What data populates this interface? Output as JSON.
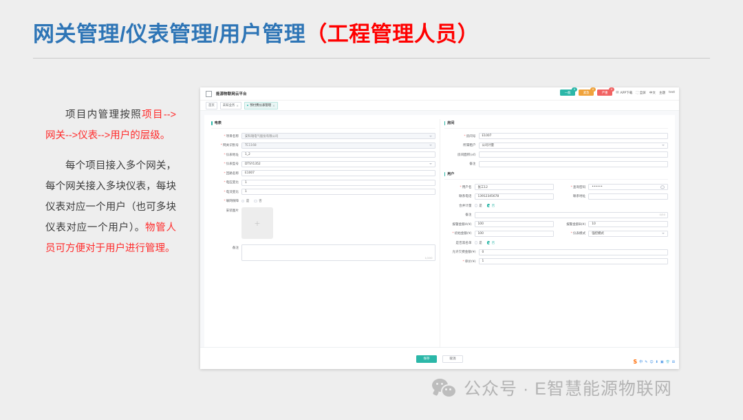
{
  "slide": {
    "title_main": "网关管理/仪表管理/用户管理",
    "title_accent": "（工程管理人员）",
    "paragraph1_prefix": "项目内管理按照",
    "paragraph1_red": "项目-->网关-->仪表-->用户的层级。",
    "paragraph2_black": "每个项目接入多个网关，每个网关接入多块仪表，每块仪表对应一个用户（也可多块仪表对应一个用户）。",
    "paragraph2_red": "物管人员可方便对于用户进行管理。"
  },
  "app": {
    "name": "能源物联网云平台",
    "topbar": {
      "badges": [
        {
          "label": "一般",
          "count": "0"
        },
        {
          "label": "紧急",
          "count": "0"
        },
        {
          "label": "严重",
          "count": "0"
        }
      ],
      "items": [
        {
          "glyph": "▤",
          "label": "APP下载"
        },
        {
          "glyph": "⛶",
          "label": "全屏"
        },
        {
          "glyph": "",
          "label": "中文"
        },
        {
          "glyph": "",
          "label": "主题"
        },
        {
          "glyph": "",
          "label": "test"
        }
      ]
    },
    "tabs": [
      {
        "label": "首页",
        "closable": false,
        "active": false
      },
      {
        "label": "未知业务",
        "closable": true,
        "active": false
      },
      {
        "label": "预付费仪表管理",
        "closable": true,
        "active": true
      }
    ],
    "meter_section": {
      "title": "电表",
      "fields": [
        {
          "label": "项目名称",
          "required": true,
          "value": "安科瑞电气股份有限公司",
          "type": "select",
          "disabled": true
        },
        {
          "label": "网关识别号",
          "required": true,
          "value": "TC1168",
          "type": "select",
          "disabled": true
        },
        {
          "label": "仪表地址",
          "required": true,
          "value": "1_2",
          "type": "input",
          "disabled": false
        },
        {
          "label": "仪表型号",
          "required": true,
          "value": "DTSY1352",
          "type": "select",
          "disabled": false
        },
        {
          "label": "回路名称",
          "required": true,
          "value": "E1007",
          "type": "input",
          "disabled": false
        },
        {
          "label": "电压变比",
          "required": true,
          "value": "1",
          "type": "input",
          "disabled": false
        },
        {
          "label": "电流变比",
          "required": true,
          "value": "1",
          "type": "input",
          "disabled": false
        }
      ],
      "radio_group": {
        "label": "联网保障",
        "required": true,
        "options": [
          "是",
          "否"
        ],
        "selected": ""
      },
      "upload": {
        "label": "安装图片",
        "glyph": "+"
      },
      "remark": {
        "label": "备注",
        "value": "",
        "count": "1/200"
      }
    },
    "room_section": {
      "title": "房间",
      "fields": [
        {
          "label": "房间号",
          "required": true,
          "value": "E1007",
          "type": "input",
          "disabled": false
        },
        {
          "label": "所属租户",
          "required": false,
          "value": "公司计量",
          "type": "select",
          "disabled": false
        },
        {
          "label": "房间面积(㎡)",
          "required": false,
          "value": "",
          "type": "input",
          "disabled": false
        },
        {
          "label": "备注",
          "required": false,
          "value": "",
          "type": "input",
          "disabled": false
        }
      ]
    },
    "user_section": {
      "title": "用户",
      "row_user": [
        {
          "label": "用户名",
          "required": true,
          "value": "张工12",
          "type": "input"
        },
        {
          "label": "查询密码",
          "required": true,
          "value": "••••••",
          "type": "password"
        }
      ],
      "row_contact": [
        {
          "label": "联系电话",
          "required": false,
          "value": "13912345678",
          "type": "input"
        },
        {
          "label": "联系地址",
          "required": false,
          "value": "",
          "type": "input"
        }
      ],
      "merge_radio": {
        "label": "合并计量",
        "options": [
          "是",
          "否"
        ],
        "selected": "否"
      },
      "remark": {
        "label": "备注",
        "value": "",
        "count": "0/50"
      },
      "row_alarm": [
        {
          "label": "报警金额A(¥)",
          "required": false,
          "value": "100",
          "type": "input"
        },
        {
          "label": "报警金额B(¥)",
          "required": false,
          "value": "10",
          "type": "input"
        }
      ],
      "row_init": [
        {
          "label": "初始金额(¥)",
          "required": true,
          "value": "100",
          "type": "input"
        },
        {
          "label": "仪表模式",
          "required": true,
          "value": "强控模式",
          "type": "select"
        }
      ],
      "blacklist_radio": {
        "label": "是否黑名单",
        "options": [
          "是",
          "否"
        ],
        "selected": "否"
      },
      "row_owe": [
        {
          "label": "允许欠费金额(¥)",
          "required": false,
          "value": "0",
          "type": "input"
        }
      ],
      "row_price": [
        {
          "label": "单价(¥)",
          "required": true,
          "value": "1",
          "type": "input"
        }
      ]
    },
    "footer": {
      "save_label": "保存",
      "cancel_label": "取消",
      "ime_logo": "S",
      "ime_icons": [
        "中",
        "✎",
        "☺",
        "⬇",
        "▣",
        "👕",
        "⊞"
      ]
    }
  },
  "watermark": {
    "text": "公众号 · E智慧能源物联网"
  },
  "colors": {
    "title_blue": "#2e75b6",
    "accent_red": "#ff0000",
    "app_teal": "#2bb7a8",
    "required_red": "#f56c6c"
  }
}
